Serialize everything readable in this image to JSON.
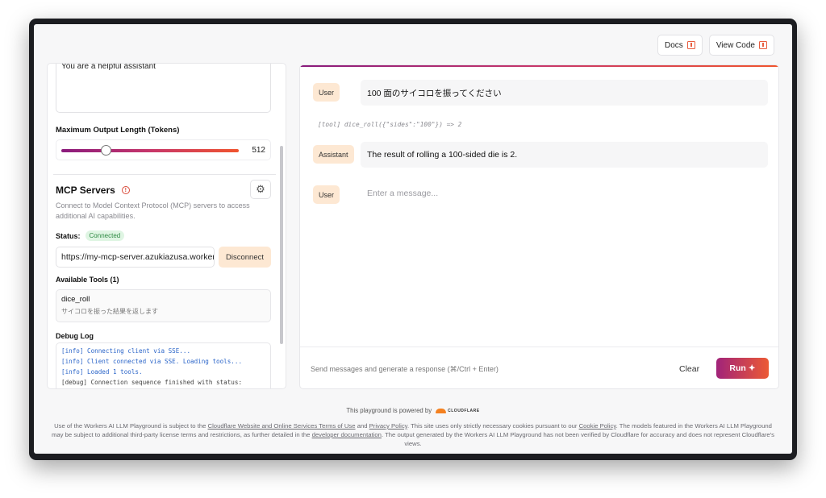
{
  "topbar": {
    "docs_label": "Docs",
    "view_code_label": "View Code"
  },
  "left": {
    "system_prompt_value": "You are a helpful assistant",
    "max_tokens_label": "Maximum Output Length (Tokens)",
    "max_tokens_value": "512",
    "mcp_title": "MCP Servers",
    "mcp_desc": "Connect to Model Context Protocol (MCP) servers to access additional AI capabilities.",
    "status_label": "Status:",
    "status_value": "Connected",
    "server_url": "https://my-mcp-server.azukiazusa.workers.dev/sse",
    "disconnect_label": "Disconnect",
    "tools_label": "Available Tools (1)",
    "tools": [
      {
        "name": "dice_roll",
        "desc": "サイコロを振った結果を返します"
      }
    ],
    "debug_label": "Debug Log",
    "debug_log": [
      {
        "level": "info",
        "text": "[info] Connecting client via SSE..."
      },
      {
        "level": "info",
        "text": "[info] Client connected via SSE. Loading tools..."
      },
      {
        "level": "info",
        "text": "[info] Loaded 1 tools."
      },
      {
        "level": "debug",
        "text": "[debug] Connection sequence finished with status: success"
      }
    ]
  },
  "chat": {
    "messages": [
      {
        "role": "User",
        "text": "100 面のサイコロを振ってください"
      },
      {
        "role": "Assistant",
        "text": "The result of rolling a 100-sided die is 2."
      }
    ],
    "tool_call": "[tool] dice_roll({\"sides\":\"100\"}) => 2",
    "input_role": "User",
    "input_placeholder": "Enter a message...",
    "footer_hint": "Send messages and generate a response (⌘/Ctrl + Enter)",
    "clear_label": "Clear",
    "run_label": "Run"
  },
  "footer": {
    "powered_by": "This playground is powered by",
    "cf_wordmark": "CLOUDFLARE",
    "legal_1": "Use of the Workers AI LLM Playground is subject to the",
    "legal_link_1": "Cloudflare Website and Online Services Terms of Use",
    "legal_2": "and",
    "legal_link_2": "Privacy Policy",
    "legal_3": ". This site uses only strictly necessary cookies pursuant to our",
    "legal_link_3": "Cookie Policy",
    "legal_4": ". The models featured in the Workers AI LLM Playground may be subject to additional third-party license terms and restrictions, as further detailed in the",
    "legal_link_4": "developer documentation",
    "legal_5": ". The output generated by the Workers AI LLM Playground has not been verified by Cloudflare for accuracy and does not represent Cloudflare's views."
  },
  "colors": {
    "accent_start": "#8a1b7d",
    "accent_end": "#f0542e",
    "role_badge": "#fde8d3",
    "status_green": "#2f8a44"
  },
  "slider": {
    "fraction": 0.25
  }
}
